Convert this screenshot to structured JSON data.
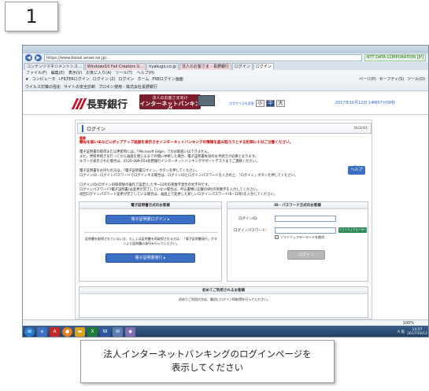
{
  "step_number": "1",
  "browser": {
    "url": "https://www.bizsol.anser.ne.jp/...",
    "site_badge": "NTT DATA CORPORATION [JP]",
    "tabs": [
      {
        "label": "コンテンツマネジメントシス..."
      },
      {
        "label": "Windows10 Fall Creators U..."
      },
      {
        "label": "hyakugo.co.jp"
      },
      {
        "label": "法人のお客さま - 長野銀行"
      },
      {
        "label": "ログイン"
      },
      {
        "label": "ログイン"
      }
    ],
    "menu": [
      "ファイル(F)",
      "編集(E)",
      "表示(V)",
      "お気に入り(A)",
      "ツール(T)",
      "ヘルプ(H)"
    ],
    "favorites": [
      "コンピュータ",
      "i-FILTERログイン",
      "ログイン (2)",
      "ログイン",
      "ホーム",
      "PSEログイン画面"
    ],
    "favorites_right": [
      "ページ(P)",
      "セーフティ(S)",
      "ツール(O)"
    ],
    "command_left": [
      "ウイルス対策の強化",
      "サイトの安全診断",
      "プロキシ使用 - 株式会社長野銀行"
    ],
    "zoom": "100%"
  },
  "bank": {
    "name": "長野銀行",
    "badge_line1": "法人のお客さま向け",
    "badge_line2": "インターネットバンキング",
    "font_size_label": "文字サイズを変更",
    "font_sizes": [
      "小",
      "中",
      "大"
    ],
    "datetime": "2017年10月12日 14時57分09秒"
  },
  "login_page": {
    "title": "ログイン",
    "screen_code": "BLGI001",
    "caution_label": "重要",
    "caution_text": "類似を装いIEなどにポップアップ画面を表示させインターネットバンキングの情報を盗み取ろうとする犯罪に十分ご注意ください。",
    "paragraphs": [
      "電子証明書の取得または更新時には、「Microsoft Edge」でのお取扱いはできません。",
      "また、更新手続きを行ってから画面を閉じるまでの間に中断した場合、電子証明書失効のお手続きが必要となります。",
      "エラーが表示された場合は、0120-089-054長野銀行インターネットバンキングサポートデスクまでご連絡ください。",
      "電子証明書をお持ちの方は、「電子証明書ログイン」ボタンを押してください。",
      "ログインID・ログインパスワードでログインする場合は、ログインIDとログインパスワードを入力の上、「ログイン」ボタンを押してください。",
      "ログインID(ログインID取得後の操作で設定)した半~12桁の英数字混合の文字列です。",
      "ログインパスワード(電子証明書)は変更が完了していない場合は、申込書類に記載の8桁の英数字を入力してください。",
      "初回ログインパスワード変更が完了している場合は、画面上で変更した新しいログインパスワード(6~12桁)を入力してください。"
    ],
    "help_label": "ヘルプ",
    "cert_box": {
      "header": "電子証明書方式のお客様",
      "login_button": "電子証明書ログイン ▸",
      "note": "証明書を取得されていない方、もしくは証明書を再取得される方は、「電子証明書発行」ボタンより証明書の発行を行ってください。",
      "issue_button": "電子証明書発行 ▸"
    },
    "id_box": {
      "header": "ID・パスワード方式のお客様",
      "id_label": "ログインID:",
      "password_label": "ログインパスワード:",
      "software_keyboard_toggle": "ソフトウェアキーボードを開く",
      "software_keyboard_checkbox": "ソフトウェアキーボードを使用",
      "login_button": "ログイン"
    },
    "first_box": {
      "header": "初めてご利用されるお客様",
      "note": "初めてご利用の方は、最初にログインID取得を行ってください。"
    }
  },
  "taskbar": {
    "time": "14:57",
    "date": "2017/10/12",
    "language": "A 般"
  },
  "instruction": {
    "line1": "法人インターネットバンキングのログインページを",
    "line2": "表示してください"
  },
  "colors": {
    "bank_red": "#c8102e",
    "badge_maroon": "#7c1d2c",
    "button_blue": "#3a6fc3",
    "caution_red": "#cc0000"
  }
}
